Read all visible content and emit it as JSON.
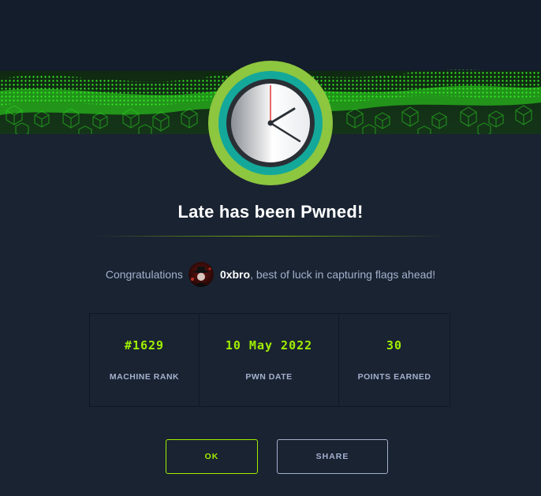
{
  "modal": {
    "title": "Late has been Pwned!",
    "congrats_prefix": "Congratulations",
    "username": "0xbro",
    "congrats_suffix": ", best of luck in capturing flags ahead!"
  },
  "stats": [
    {
      "value": "#1629",
      "label": "MACHINE RANK"
    },
    {
      "value": "10 May 2022",
      "label": "PWN DATE"
    },
    {
      "value": "30",
      "label": "POINTS EARNED"
    }
  ],
  "buttons": {
    "ok_label": "OK",
    "share_label": "SHARE"
  },
  "icons": {
    "badge": "clock-icon",
    "avatar": "user-avatar"
  },
  "colors": {
    "accent": "#9fef00",
    "background": "#1a2332",
    "text_muted": "#a4b1cd",
    "badge_ring_outer": "#8dc63f",
    "badge_ring_inner": "#14a89a"
  }
}
